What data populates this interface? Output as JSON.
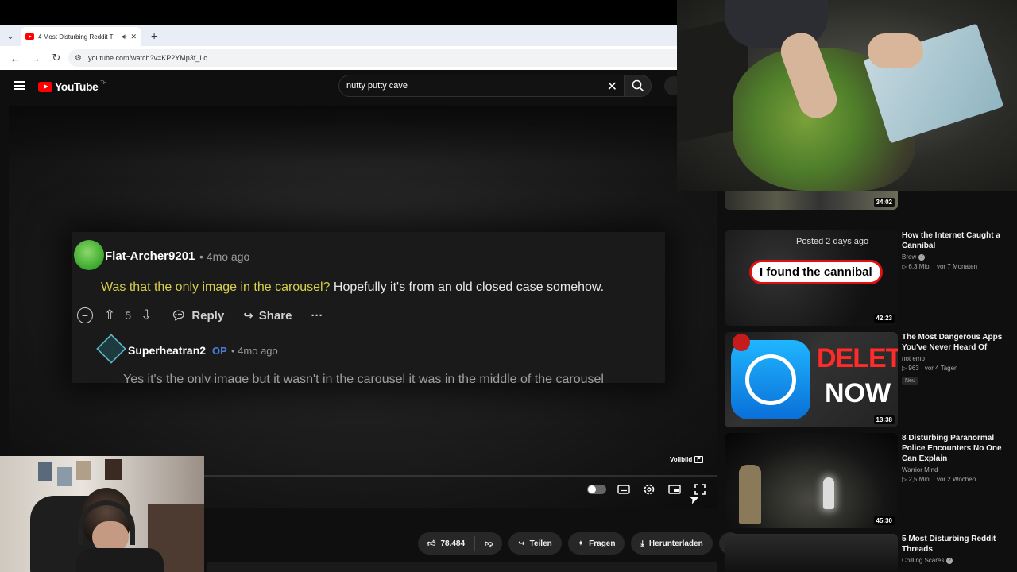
{
  "browser": {
    "tab_title": "4 Most Disturbing Reddit T",
    "url": "youtube.com/watch?v=KP2YMp3f_Lc"
  },
  "header": {
    "logo_text": "YouTube",
    "country_code": "TH",
    "search_value": "nutty putty cave"
  },
  "player": {
    "comment": {
      "user": "Flat-Archer9201",
      "time": "• 4mo ago",
      "text_highlight": "Was that the only image in the carousel?",
      "text_rest": " Hopefully it's from an old closed case somehow.",
      "votes": "5",
      "reply_label": "Reply",
      "share_label": "Share",
      "more_label": "···"
    },
    "reply": {
      "user": "Superheatran2",
      "op_tag": "OP",
      "time": "• 4mo ago",
      "text": "Yes it's the only image but it wasn't in the carousel it was in the middle of the carousel"
    },
    "tooltip_label": "Vollbild",
    "tooltip_key": "F"
  },
  "actions": {
    "likes": "78.484",
    "share": "Teilen",
    "ask": "Fragen",
    "download": "Herunterladen",
    "more": "···"
  },
  "recommendations": [
    {
      "duration": "34:02"
    },
    {
      "title": "How the Internet Caught a Cannibal",
      "channel": "Brew",
      "verified": true,
      "stats": "▷ 6,3 Mio. · vor 7 Monaten",
      "duration": "42:23",
      "thumb_posted": "Posted 2 days ago",
      "thumb_caption": "I found the cannibal"
    },
    {
      "title": "The Most Dangerous Apps You've Never Heard Of",
      "channel": "not emo",
      "stats": "▷ 963 · vor 4 Tagen",
      "badge": "Neu",
      "duration": "13:38",
      "thumb_word1": "DELETE",
      "thumb_word2": "NOW"
    },
    {
      "title": "8 Disturbing Paranormal Police Encounters No One Can Explain",
      "channel": "Warrior Mind",
      "stats": "▷ 2,5 Mio. · vor 2 Wochen",
      "duration": "45:30"
    },
    {
      "title": "5 Most Disturbing Reddit Threads",
      "channel": "Chilling Scares",
      "verified": true
    }
  ],
  "colors": {
    "yt_red": "#ff0000",
    "op_blue": "#4a7fd6",
    "highlight_yellow": "#d7d04a",
    "bg": "#0f0f0f"
  }
}
